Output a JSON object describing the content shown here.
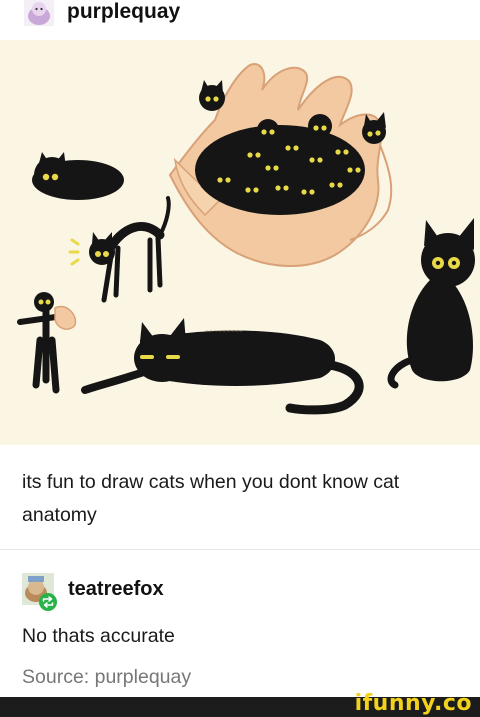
{
  "post": {
    "author": "purplequay",
    "caption": "its fun to draw cats when you dont know cat anatomy",
    "art_description_icon": "drawing-of-cats"
  },
  "reblog": {
    "author": "teatreefox",
    "comment": "No thats accurate",
    "source": "Source: purplequay",
    "reblog_badge_icon": "reblog-icon"
  },
  "footer": {
    "watermark": "ifunny.co"
  },
  "colors": {
    "art_background": "#fbf5e4",
    "reblog_badge": "#27b34a",
    "watermark": "#f2d21a"
  }
}
